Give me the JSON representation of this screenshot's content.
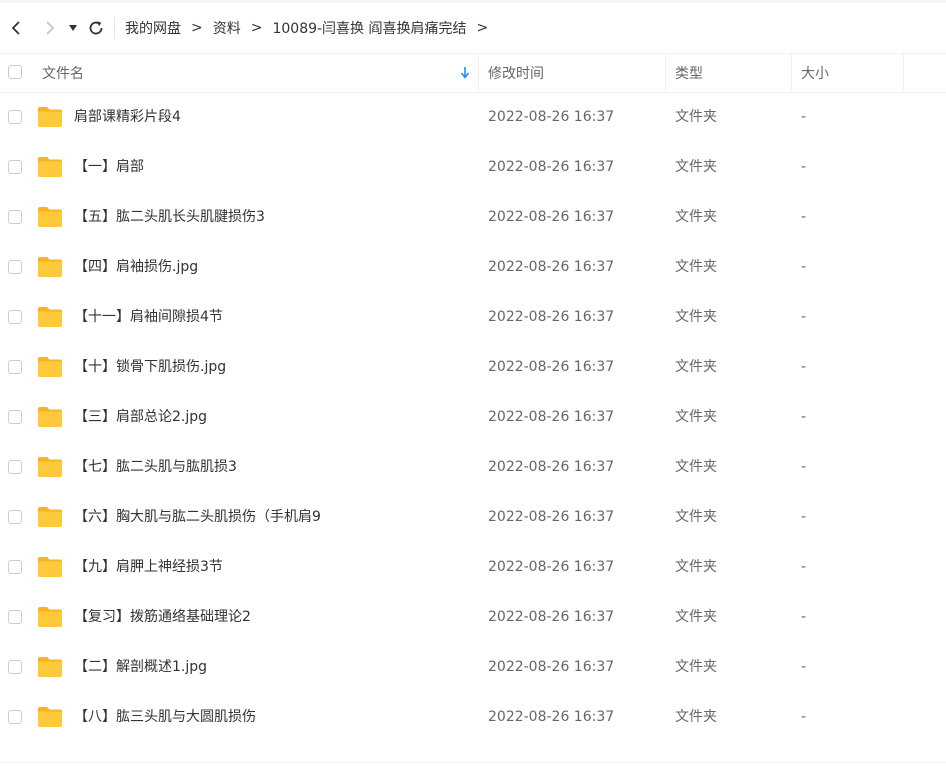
{
  "breadcrumb": {
    "items": [
      "我的网盘",
      "资料",
      "10089-闫喜换 阎喜换肩痛完结"
    ],
    "separator": ">"
  },
  "columns": {
    "name": "文件名",
    "modified": "修改时间",
    "type": "类型",
    "size": "大小"
  },
  "colors": {
    "folder": "#ffc93c",
    "folder_tab": "#f7b422",
    "sort_arrow": "#1e90ff"
  },
  "rows": [
    {
      "name": "肩部课精彩片段4",
      "modified": "2022-08-26 16:37",
      "type": "文件夹",
      "size": "-"
    },
    {
      "name": "【一】肩部",
      "modified": "2022-08-26 16:37",
      "type": "文件夹",
      "size": "-"
    },
    {
      "name": "【五】肱二头肌长头肌腱损伤3",
      "modified": "2022-08-26 16:37",
      "type": "文件夹",
      "size": "-"
    },
    {
      "name": "【四】肩袖损伤.jpg",
      "modified": "2022-08-26 16:37",
      "type": "文件夹",
      "size": "-"
    },
    {
      "name": "【十一】肩袖间隙损4节",
      "modified": "2022-08-26 16:37",
      "type": "文件夹",
      "size": "-"
    },
    {
      "name": "【十】锁骨下肌损伤.jpg",
      "modified": "2022-08-26 16:37",
      "type": "文件夹",
      "size": "-"
    },
    {
      "name": "【三】肩部总论2.jpg",
      "modified": "2022-08-26 16:37",
      "type": "文件夹",
      "size": "-"
    },
    {
      "name": "【七】肱二头肌与肱肌损3",
      "modified": "2022-08-26 16:37",
      "type": "文件夹",
      "size": "-"
    },
    {
      "name": "【六】胸大肌与肱二头肌损伤（手机肩9",
      "modified": "2022-08-26 16:37",
      "type": "文件夹",
      "size": "-"
    },
    {
      "name": "【九】肩胛上神经损3节",
      "modified": "2022-08-26 16:37",
      "type": "文件夹",
      "size": "-"
    },
    {
      "name": "【复习】拨筋通络基础理论2",
      "modified": "2022-08-26 16:37",
      "type": "文件夹",
      "size": "-"
    },
    {
      "name": "【二】解剖概述1.jpg",
      "modified": "2022-08-26 16:37",
      "type": "文件夹",
      "size": "-"
    },
    {
      "name": "【八】肱三头肌与大圆肌损伤",
      "modified": "2022-08-26 16:37",
      "type": "文件夹",
      "size": "-"
    }
  ]
}
